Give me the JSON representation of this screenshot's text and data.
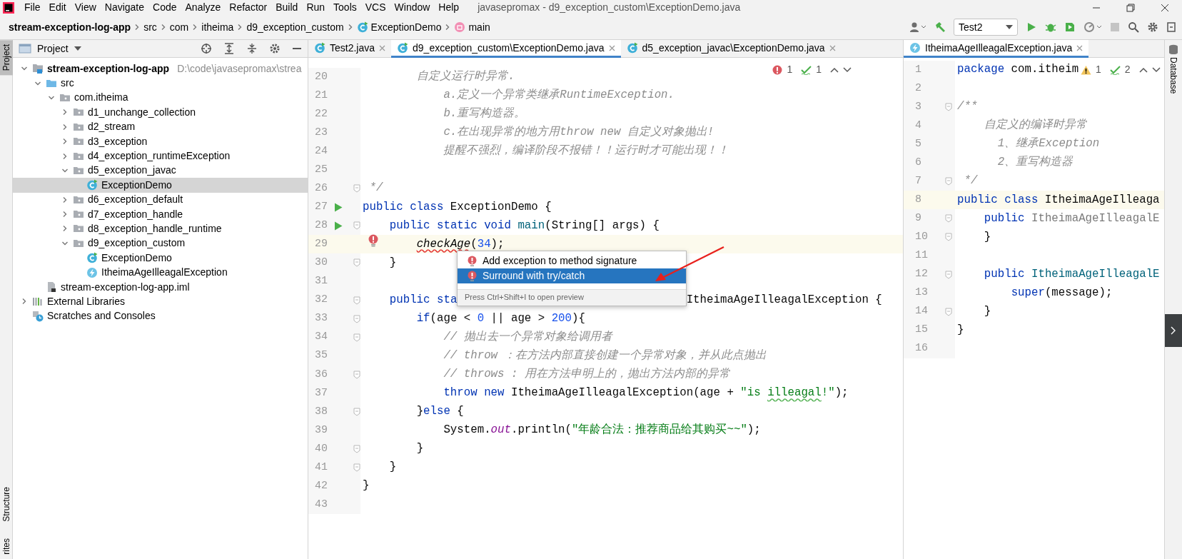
{
  "menu": [
    "File",
    "Edit",
    "View",
    "Navigate",
    "Code",
    "Analyze",
    "Refactor",
    "Build",
    "Run",
    "Tools",
    "VCS",
    "Window",
    "Help"
  ],
  "window_title": "javasepromax - d9_exception_custom\\ExceptionDemo.java",
  "breadcrumbs": [
    {
      "label": "stream-exception-log-app",
      "kind": "project"
    },
    {
      "label": "src",
      "kind": "dir"
    },
    {
      "label": "com",
      "kind": "dir"
    },
    {
      "label": "itheima",
      "kind": "dir"
    },
    {
      "label": "d9_exception_custom",
      "kind": "dir"
    },
    {
      "label": "ExceptionDemo",
      "kind": "class"
    },
    {
      "label": "main",
      "kind": "method"
    }
  ],
  "run_config": "Test2",
  "left_stripe": [
    {
      "label": "Project",
      "selected": true
    },
    {
      "label": "Structure",
      "selected": false
    },
    {
      "label": "rites",
      "selected": false
    }
  ],
  "project_panel": {
    "title": "Project",
    "tree": [
      {
        "label": "stream-exception-log-app",
        "kind": "module",
        "hint": "D:\\code\\javasepromax\\strea",
        "expanded": true,
        "selected": false,
        "children": [
          {
            "label": "src",
            "kind": "source",
            "expanded": true,
            "selected": false,
            "children": [
              {
                "label": "com.itheima",
                "kind": "package",
                "expanded": true,
                "selected": false,
                "children": [
                  {
                    "label": "d1_unchange_collection",
                    "kind": "package",
                    "expanded": false,
                    "selected": false
                  },
                  {
                    "label": "d2_stream",
                    "kind": "package",
                    "expanded": false,
                    "selected": false
                  },
                  {
                    "label": "d3_exception",
                    "kind": "package",
                    "expanded": false,
                    "selected": false
                  },
                  {
                    "label": "d4_exception_runtimeException",
                    "kind": "package",
                    "expanded": false,
                    "selected": false
                  },
                  {
                    "label": "d5_exception_javac",
                    "kind": "package",
                    "expanded": true,
                    "selected": false,
                    "children": [
                      {
                        "label": "ExceptionDemo",
                        "kind": "class",
                        "selected": true
                      }
                    ]
                  },
                  {
                    "label": "d6_exception_default",
                    "kind": "package",
                    "expanded": false,
                    "selected": false
                  },
                  {
                    "label": "d7_exception_handle",
                    "kind": "package",
                    "expanded": false,
                    "selected": false
                  },
                  {
                    "label": "d8_exception_handle_runtime",
                    "kind": "package",
                    "expanded": false,
                    "selected": false
                  },
                  {
                    "label": "d9_exception_custom",
                    "kind": "package",
                    "expanded": true,
                    "selected": false,
                    "children": [
                      {
                        "label": "ExceptionDemo",
                        "kind": "class",
                        "selected": false
                      },
                      {
                        "label": "ItheimaAgeIlleagalException",
                        "kind": "exception",
                        "selected": false
                      }
                    ]
                  }
                ]
              }
            ]
          },
          {
            "label": "stream-exception-log-app.iml",
            "kind": "file",
            "selected": false
          }
        ]
      },
      {
        "label": "External Libraries",
        "kind": "libraries",
        "expanded": false,
        "selected": false
      },
      {
        "label": "Scratches and Consoles",
        "kind": "scratches",
        "selected": false
      }
    ]
  },
  "editor": {
    "tabs": [
      {
        "label": "Test2.java",
        "kind": "class",
        "selected": false
      },
      {
        "label": "d9_exception_custom\\ExceptionDemo.java",
        "kind": "class",
        "selected": true
      },
      {
        "label": "d5_exception_javac\\ExceptionDemo.java",
        "kind": "class",
        "selected": false
      }
    ],
    "inspections": [
      {
        "kind": "error",
        "count": "1"
      },
      {
        "kind": "typo",
        "count": "1"
      }
    ],
    "lines": [
      {
        "n": "20",
        "current": false,
        "run": false,
        "fold": false,
        "error": false,
        "code": [
          {
            "kind": "c",
            "text": "        自定义运行时异常."
          }
        ]
      },
      {
        "n": "21",
        "current": false,
        "run": false,
        "fold": false,
        "error": false,
        "code": [
          {
            "kind": "c",
            "text": "            a.定义一个异常类继承RuntimeException."
          }
        ]
      },
      {
        "n": "22",
        "current": false,
        "run": false,
        "fold": false,
        "error": false,
        "code": [
          {
            "kind": "c",
            "text": "            b.重写构造器。"
          }
        ]
      },
      {
        "n": "23",
        "current": false,
        "run": false,
        "fold": false,
        "error": false,
        "code": [
          {
            "kind": "c",
            "text": "            c.在出现异常的地方用throw new 自定义对象抛出!"
          }
        ]
      },
      {
        "n": "24",
        "current": false,
        "run": false,
        "fold": false,
        "error": false,
        "code": [
          {
            "kind": "c",
            "text": "            提醒不强烈，编译阶段不报错！！运行时才可能出现！！"
          }
        ]
      },
      {
        "n": "25",
        "current": false,
        "run": false,
        "fold": false,
        "error": false
      },
      {
        "n": "26",
        "current": false,
        "run": false,
        "fold": true,
        "error": false,
        "code": [
          {
            "kind": "c",
            "text": " */"
          }
        ]
      },
      {
        "n": "27",
        "current": false,
        "run": true,
        "fold": false,
        "error": false,
        "code": [
          {
            "kind": "k",
            "text": "public class"
          },
          {
            "kind": "p",
            "text": " ExceptionDemo {"
          }
        ]
      },
      {
        "n": "28",
        "current": false,
        "run": true,
        "fold": true,
        "error": false,
        "code": [
          {
            "kind": "k",
            "text": "    public static void "
          },
          {
            "kind": "m",
            "text": "main"
          },
          {
            "kind": "p",
            "text": "(String[] args) {"
          }
        ]
      },
      {
        "n": "29",
        "current": true,
        "run": false,
        "fold": false,
        "error": true,
        "code": [
          {
            "kind": "ce",
            "text": "        checkAge"
          },
          {
            "kind": "p",
            "text": "("
          },
          {
            "kind": "n",
            "text": "34"
          },
          {
            "kind": "p",
            "text": ");"
          }
        ]
      },
      {
        "n": "30",
        "current": false,
        "run": false,
        "fold": true,
        "error": false,
        "code": [
          {
            "kind": "p",
            "text": "    }"
          }
        ]
      },
      {
        "n": "31",
        "current": false,
        "run": false,
        "fold": false,
        "error": false
      },
      {
        "n": "32",
        "current": false,
        "run": false,
        "fold": true,
        "error": false,
        "code": [
          {
            "kind": "k",
            "text": "    public sta"
          }
        ],
        "code_after": [
          {
            "kind": "p",
            "text": "ItheimaAgeIlleagalException {"
          }
        ]
      },
      {
        "n": "33",
        "current": false,
        "run": false,
        "fold": true,
        "error": false,
        "code": [
          {
            "kind": "k",
            "text": "        if"
          },
          {
            "kind": "p",
            "text": "(age < "
          },
          {
            "kind": "n",
            "text": "0"
          },
          {
            "kind": "p",
            "text": " || age > "
          },
          {
            "kind": "n",
            "text": "200"
          },
          {
            "kind": "p",
            "text": "){"
          }
        ]
      },
      {
        "n": "34",
        "current": false,
        "run": false,
        "fold": true,
        "error": false,
        "code": [
          {
            "kind": "c",
            "text": "            // 抛出去一个异常对象给调用者"
          }
        ]
      },
      {
        "n": "35",
        "current": false,
        "run": false,
        "fold": false,
        "error": false,
        "code": [
          {
            "kind": "c",
            "text": "            // throw ：在方法内部直接创建一个异常对象，并从此点抛出"
          }
        ]
      },
      {
        "n": "36",
        "current": false,
        "run": false,
        "fold": true,
        "error": false,
        "code": [
          {
            "kind": "c",
            "text": "            // throws : 用在方法申明上的，抛出方法内部的异常"
          }
        ]
      },
      {
        "n": "37",
        "current": false,
        "run": false,
        "fold": false,
        "error": false,
        "code": [
          {
            "kind": "k",
            "text": "            throw new"
          },
          {
            "kind": "p",
            "text": " ItheimaAgeIlleagalException(age + "
          },
          {
            "kind": "s",
            "text": "\"is "
          },
          {
            "kind": "sw",
            "text": "illeagal"
          },
          {
            "kind": "s",
            "text": "!\""
          },
          {
            "kind": "p",
            "text": ");"
          }
        ]
      },
      {
        "n": "38",
        "current": false,
        "run": false,
        "fold": true,
        "error": false,
        "code": [
          {
            "kind": "p",
            "text": "        }"
          },
          {
            "kind": "k",
            "text": "else"
          },
          {
            "kind": "p",
            "text": " {"
          }
        ]
      },
      {
        "n": "39",
        "current": false,
        "run": false,
        "fold": false,
        "error": false,
        "code": [
          {
            "kind": "p",
            "text": "            System."
          },
          {
            "kind": "f",
            "text": "out"
          },
          {
            "kind": "p",
            "text": ".println("
          },
          {
            "kind": "s",
            "text": "\"年龄合法：推荐商品给其购买~~\""
          },
          {
            "kind": "p",
            "text": ");"
          }
        ]
      },
      {
        "n": "40",
        "current": false,
        "run": false,
        "fold": true,
        "error": false,
        "code": [
          {
            "kind": "p",
            "text": "        }"
          }
        ]
      },
      {
        "n": "41",
        "current": false,
        "run": false,
        "fold": true,
        "error": false,
        "code": [
          {
            "kind": "p",
            "text": "    }"
          }
        ]
      },
      {
        "n": "42",
        "current": false,
        "run": false,
        "fold": false,
        "error": false,
        "code": [
          {
            "kind": "p",
            "text": "}"
          }
        ]
      },
      {
        "n": "43",
        "current": false,
        "run": false,
        "fold": false,
        "error": false
      }
    ]
  },
  "popup": {
    "items": [
      {
        "label": "Add exception to method signature",
        "selected": false
      },
      {
        "label": "Surround with try/catch",
        "selected": true
      }
    ],
    "hint": "Press Ctrl+Shift+I to open preview"
  },
  "right_editor": {
    "tabs": [
      {
        "label": "ItheimaAgeIlleagalException.java",
        "kind": "exception",
        "selected": true
      }
    ],
    "inspections": [
      {
        "kind": "warning",
        "count": "1"
      },
      {
        "kind": "typo",
        "count": "2"
      }
    ],
    "lines": [
      {
        "n": "1",
        "current": false,
        "run": false,
        "fold": false,
        "error": false,
        "code": [
          {
            "kind": "k",
            "text": "package"
          },
          {
            "kind": "p",
            "text": " com.itheim"
          }
        ]
      },
      {
        "n": "2",
        "current": false,
        "run": false,
        "fold": false,
        "error": false
      },
      {
        "n": "3",
        "current": false,
        "run": false,
        "fold": true,
        "error": false,
        "code": [
          {
            "kind": "c",
            "text": "/**"
          }
        ]
      },
      {
        "n": "4",
        "current": false,
        "run": false,
        "fold": false,
        "error": false,
        "code": [
          {
            "kind": "c",
            "text": "    自定义的编译时异常"
          }
        ]
      },
      {
        "n": "5",
        "current": false,
        "run": false,
        "fold": false,
        "error": false,
        "code": [
          {
            "kind": "c",
            "text": "      1、继承Exception"
          }
        ]
      },
      {
        "n": "6",
        "current": false,
        "run": false,
        "fold": false,
        "error": false,
        "code": [
          {
            "kind": "c",
            "text": "      2、重写构造器"
          }
        ]
      },
      {
        "n": "7",
        "current": false,
        "run": false,
        "fold": true,
        "error": false,
        "code": [
          {
            "kind": "c",
            "text": " */"
          }
        ]
      },
      {
        "n": "8",
        "current": true,
        "run": false,
        "fold": false,
        "error": false,
        "code": [
          {
            "kind": "k",
            "text": "public class"
          },
          {
            "kind": "p",
            "text": " ItheimaAgeIlleaga"
          }
        ]
      },
      {
        "n": "9",
        "current": false,
        "run": false,
        "fold": true,
        "error": false,
        "code": [
          {
            "kind": "k",
            "text": "    public "
          },
          {
            "kind": "u",
            "text": "ItheimaAgeIlleagalE"
          }
        ]
      },
      {
        "n": "10",
        "current": false,
        "run": false,
        "fold": true,
        "error": false,
        "code": [
          {
            "kind": "p",
            "text": "    }"
          }
        ]
      },
      {
        "n": "11",
        "current": false,
        "run": false,
        "fold": false,
        "error": false
      },
      {
        "n": "12",
        "current": false,
        "run": false,
        "fold": true,
        "error": false,
        "code": [
          {
            "kind": "k",
            "text": "    public "
          },
          {
            "kind": "m",
            "text": "ItheimaAgeIlleagalE"
          }
        ]
      },
      {
        "n": "13",
        "current": false,
        "run": false,
        "fold": false,
        "error": false,
        "code": [
          {
            "kind": "k",
            "text": "        super"
          },
          {
            "kind": "p",
            "text": "(message);"
          }
        ]
      },
      {
        "n": "14",
        "current": false,
        "run": false,
        "fold": true,
        "error": false,
        "code": [
          {
            "kind": "p",
            "text": "    }"
          }
        ]
      },
      {
        "n": "15",
        "current": false,
        "run": false,
        "fold": false,
        "error": false,
        "code": [
          {
            "kind": "p",
            "text": "}"
          }
        ]
      },
      {
        "n": "16",
        "current": false,
        "run": false,
        "fold": false,
        "error": false
      }
    ]
  },
  "right_stripe": [
    {
      "label": "Database"
    }
  ]
}
